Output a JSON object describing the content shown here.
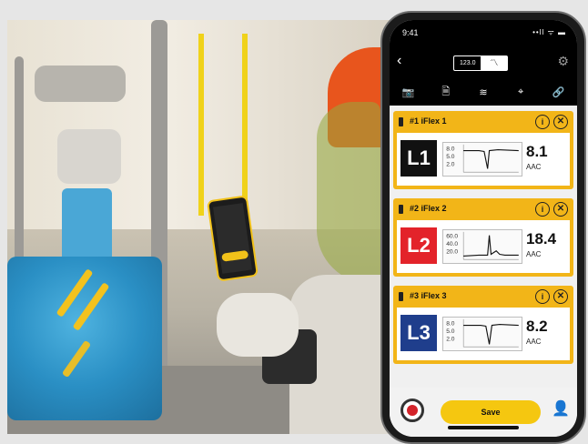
{
  "phone": {
    "status": {
      "time": "9:41",
      "system": "••ll ᯤ ▬"
    },
    "nav": {
      "back_icon": "chevron-left-icon",
      "toggle_value": "123.0",
      "toggle_chart_glyph": "〽",
      "settings_icon": "gear-icon"
    },
    "toolbar": [
      {
        "icon": "camera-icon",
        "glyph": "📷"
      },
      {
        "icon": "add-document-icon",
        "glyph": "🗎"
      },
      {
        "icon": "wireless-sensor-icon",
        "glyph": "≋"
      },
      {
        "icon": "tag-icon",
        "glyph": "⌖"
      },
      {
        "icon": "link-icon",
        "glyph": "🔗"
      }
    ],
    "cards": [
      {
        "title": "#1 iFlex 1",
        "label": "L1",
        "label_color": "#111111",
        "value": "8.1",
        "unit": "AAC",
        "spark_ticks": [
          "8.0",
          "5.0",
          "2.0"
        ]
      },
      {
        "title": "#2 iFlex 2",
        "label": "L2",
        "label_color": "#e3232a",
        "value": "18.4",
        "unit": "AAC",
        "spark_ticks": [
          "60.0",
          "40.0",
          "20.0"
        ]
      },
      {
        "title": "#3 iFlex 3",
        "label": "L3",
        "label_color": "#1f3e8c",
        "value": "8.2",
        "unit": "AAC",
        "spark_ticks": [
          "8.0",
          "5.0",
          "2.0"
        ]
      }
    ],
    "card_info": "i",
    "card_close": "✕",
    "bottom": {
      "save_label": "Save",
      "record_icon": "record-icon",
      "share_icon": "user-share-icon"
    },
    "colors": {
      "accent": "#f2b518",
      "screen_bg": "#f0f0f0",
      "record": "#d3232a"
    }
  }
}
